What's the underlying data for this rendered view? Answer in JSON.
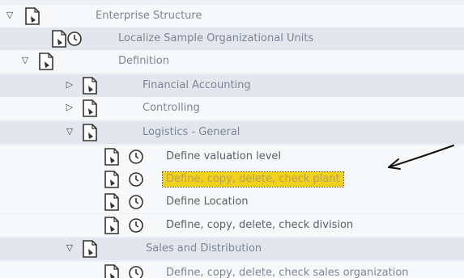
{
  "tree": {
    "root": {
      "label": "Enterprise Structure"
    },
    "localize": {
      "label": "Localize Sample Organizational Units"
    },
    "definition": {
      "label": "Definition"
    },
    "financial": {
      "label": "Financial Accounting"
    },
    "controlling": {
      "label": "Controlling"
    },
    "logistics": {
      "label": "Logistics - General"
    },
    "valuation": {
      "label": "Define valuation level"
    },
    "plant": {
      "label": "Define, copy, delete, check plant",
      "selected": true
    },
    "location": {
      "label": "Define Location"
    },
    "division": {
      "label": "Define, copy, delete, check division"
    },
    "sales": {
      "label": "Sales and Distribution"
    },
    "sales_org": {
      "label": "Define, copy, delete, check sales organization"
    }
  },
  "colors": {
    "selection": "#f2d11a",
    "arrow": "#111111"
  }
}
